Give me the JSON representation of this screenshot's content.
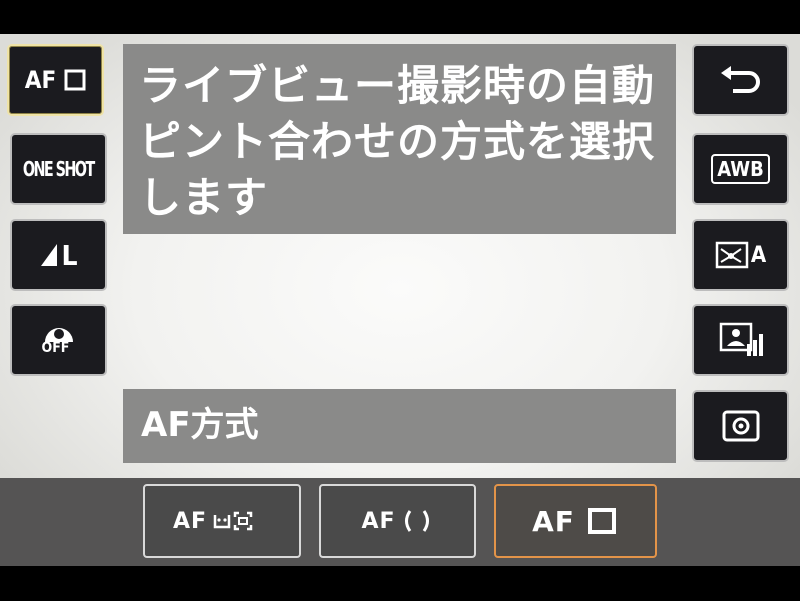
{
  "left_column": [
    {
      "id": "af-mode",
      "label": "AF",
      "icon": "af-single-point-icon",
      "selected": true
    },
    {
      "id": "drive",
      "label": "ONE SHOT",
      "icon": "one-shot-icon"
    },
    {
      "id": "quality",
      "label": "L",
      "icon": "large-quality-icon"
    },
    {
      "id": "alo",
      "label": "OFF",
      "icon": "auto-lighting-off-icon"
    }
  ],
  "right_column": [
    {
      "id": "back",
      "icon": "return-arrow-icon"
    },
    {
      "id": "wb",
      "label": "AWB",
      "icon": "awb-icon"
    },
    {
      "id": "picture-style",
      "label": "A",
      "icon": "picture-style-auto-icon"
    },
    {
      "id": "display",
      "icon": "display-info-icon"
    },
    {
      "id": "metering",
      "icon": "evaluative-metering-icon"
    }
  ],
  "description": {
    "lines": [
      "ライブビュー撮影時の自動",
      "ピント合わせの方式を選択",
      "します"
    ]
  },
  "title": "AF方式",
  "options": [
    {
      "id": "face-tracking",
      "label": "AF",
      "icon": "face-tracking-icon"
    },
    {
      "id": "zone",
      "label": "AF",
      "icon": "zone-brackets-icon"
    },
    {
      "id": "single-point",
      "label": "AF",
      "icon": "single-point-square-icon",
      "selected": true
    }
  ],
  "colors": {
    "panel": "#8a8a89",
    "selected_option_border": "#e39449",
    "selected_side_border": "#efe3a6"
  }
}
